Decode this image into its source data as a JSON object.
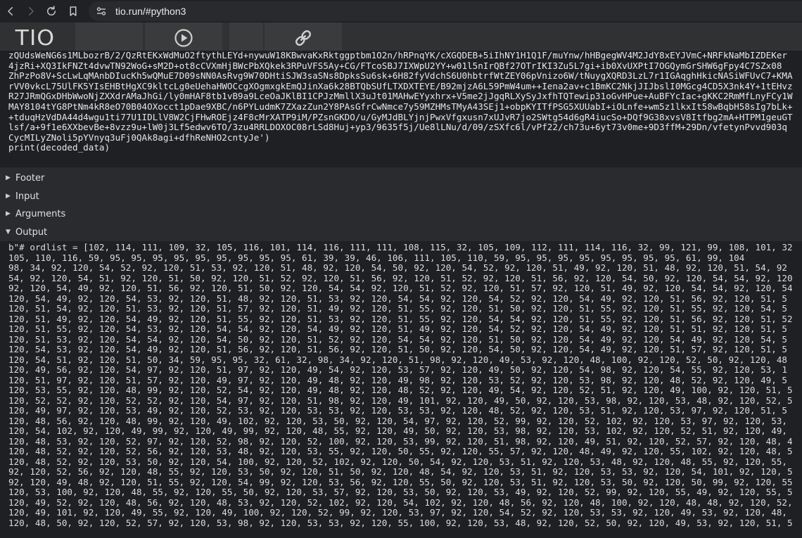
{
  "browser": {
    "url": "tio.run/#python3"
  },
  "toolbar": {
    "logo": "TIO"
  },
  "code": {
    "lines": [
      "zQUdsWeNG6s1MLbozrB/2/QzRtEKxWdMuO2ftythLEYd+nywuW18KBwvaKxRktggptbm1O2n/hRPnqYK/cXGQDEB+5iIhNY1H1Q1F/muYnw/hHBgegWV4M2JdY8xEYJVmC+NRFkNaMbIZDEKer",
      "4jzRi+XQ3IkFNZt4dvwTN92WoG+sM2D+ot8cCVXmHjBWcPbXQkek3RPuVFS5Ay+CG/FTcoSBJ7IXWpU2YY+w01l5nIrQBf27OTrIKI3Zu5L7gi+ib0XvUXPtI7OGQymGrSHW6gFpy4C7SZx08",
      "ZhPzPo8V+ScLwLqMAnbDIucKh5wQMuE7D09sNN0AsRvg9W70DHtiSJW3saSNs8DpksSu6sk+6H82fyVdchS6U0hbtrfWtZEY06pVnizo6W/tNuygXQRD3LzL7r1IGAqghHkicNASiWFUvC7+KMA",
      "rVV0vkcL75UlFK5YIsEHBtHgXC9kltcLg0eUehaHWOCcgXOgmxgkEmQJinXa6k28BTQbSUfLTXDXTEYE/B92mjzA6L59PmW4um++Iena2av+c1BmKC2NkjJIJbslI0MGcg4CD5X3nk4Y+1tEHvz",
      "R27JRmQGxDHbWwoNjZXXdrAMaJhGi/ly0mHAF8tb1vB9a9LceOaJKlBI1CPJzMmllX3uJt01MAHwEYyxhrx+V5me2jJgqRLXySyJxfhTQTewip31oGvHPue+AuBFYcIac+gKKC2RmMfLnyFCy1W",
      "MAY8104tYG8PtNm4kR8eO70B04OXocct1pDae9XBC/n6PYLudmK7ZXazZun2Y8PAsGfrCwNmce7y59MZHMsTMyA43SEj1+obpKYITfPSG5XUUabI+iOLnfe+wm5z1lkxIt58wBqbH58sIg7bLk+",
      "+tduqHzVdDA44d4wgu1ti77U1IDLlV8W2CjFHwROEjz4F8cMrXATP9iM/PZsnGKDO/u/GyMJdBLYjnjPwxVfgxusn7xUJvR7jo2SWtg54d6gR4iucSo+DQf9G38xvsV8Itfbg2mA+HTPM1geuGT",
      "lsf/a+9f1e6XXbevBe+8vzz9u+lW0j3Lf5edwv6TO/3zu4RRLDOXOC08rLSd8Huj+yp3/9635f5j/Ue8lLNu/d/09/zSXfc6l/vPf22/ch73u+6yt73v0me+9D3ffM+29Dn/vfetynPvvd903q",
      "CycMILyZNoli5pYVnyq3uFj0QAk8agi+dfhReNHO2cntyJe')",
      "print(decoded_data)"
    ]
  },
  "sections": {
    "footer": "Footer",
    "input": "Input",
    "arguments": "Arguments",
    "output": "Output"
  },
  "output": {
    "lines": [
      "b\"# ordlist = [102, 114, 111, 109, 32, 105, 116, 101, 114, 116, 111, 111, 108, 115, 32, 105, 109, 112, 111, 114, 116, 32, 99, 121, 99, 108, 101, 32",
      "105, 110, 116, 59, 95, 95, 95, 95, 95, 95, 95, 95, 95, 61, 39, 39, 46, 106, 111, 105, 110, 59, 95, 95, 95, 95, 95, 95, 95, 95, 61, 99, 104",
      "98, 34, 92, 120, 54, 52, 92, 120, 51, 53, 92, 120, 51, 48, 92, 120, 54, 50, 92, 120, 54, 52, 92, 120, 51, 49, 92, 120, 51, 48, 92, 120, 51, 54, 92",
      "54, 92, 120, 54, 51, 92, 120, 51, 50, 92, 120, 51, 52, 92, 120, 51, 56, 92, 120, 51, 52, 92, 120, 51, 56, 92, 120, 54, 50, 92, 120, 54, 54, 92, 120",
      "92, 120, 54, 49, 92, 120, 51, 56, 92, 120, 51, 50, 92, 120, 54, 54, 92, 120, 51, 52, 92, 120, 51, 57, 92, 120, 51, 49, 92, 120, 54, 54, 92, 120, 54",
      "120, 54, 49, 92, 120, 54, 53, 92, 120, 51, 48, 92, 120, 51, 53, 92, 120, 54, 54, 92, 120, 54, 52, 92, 120, 54, 49, 92, 120, 51, 56, 92, 120, 51, 5",
      "120, 51, 54, 92, 120, 51, 53, 92, 120, 51, 57, 92, 120, 51, 49, 92, 120, 51, 55, 92, 120, 51, 50, 92, 120, 51, 55, 92, 120, 51, 55, 92, 120, 54, 5",
      "120, 51, 49, 92, 120, 54, 49, 92, 120, 51, 55, 92, 120, 51, 53, 92, 120, 51, 55, 92, 120, 54, 54, 92, 120, 51, 55, 92, 120, 51, 56, 92, 120, 51, 52",
      "120, 51, 55, 92, 120, 54, 53, 92, 120, 54, 54, 92, 120, 54, 49, 92, 120, 51, 49, 92, 120, 54, 52, 92, 120, 54, 49, 92, 120, 51, 51, 92, 120, 51, 5",
      "120, 51, 53, 92, 120, 54, 54, 92, 120, 54, 50, 92, 120, 51, 52, 92, 120, 54, 54, 92, 120, 51, 50, 92, 120, 54, 49, 92, 120, 54, 49, 92, 120, 54, 5",
      "120, 54, 53, 92, 120, 54, 49, 92, 120, 51, 56, 92, 120, 51, 56, 92, 120, 51, 50, 92, 120, 54, 50, 92, 120, 54, 49, 92, 120, 51, 57, 92, 120, 51, 5",
      "120, 54, 51, 92, 120, 51, 50, 34, 59, 95, 95, 32, 61, 32, 98, 34, 92, 120, 51, 98, 92, 120, 49, 53, 92, 120, 48, 100, 92, 120, 52, 50, 92, 120, 48",
      "120, 49, 56, 92, 120, 54, 97, 92, 120, 51, 97, 92, 120, 49, 54, 92, 120, 53, 57, 92, 120, 49, 50, 92, 120, 54, 98, 92, 120, 54, 55, 92, 120, 53, 1",
      "120, 51, 97, 92, 120, 51, 57, 92, 120, 49, 97, 92, 120, 49, 48, 92, 120, 49, 98, 92, 120, 53, 52, 92, 120, 53, 98, 92, 120, 48, 52, 92, 120, 49, 5",
      "120, 53, 55, 92, 120, 48, 99, 92, 120, 52, 54, 92, 120, 49, 48, 92, 120, 48, 52, 92, 120, 49, 54, 92, 120, 52, 51, 92, 120, 49, 100, 92, 120, 51, 5",
      "120, 52, 52, 92, 120, 52, 52, 92, 120, 54, 97, 92, 120, 51, 98, 92, 120, 49, 101, 92, 120, 49, 50, 92, 120, 53, 98, 92, 120, 53, 48, 92, 120, 52, 5",
      "120, 49, 97, 92, 120, 53, 49, 92, 120, 52, 53, 92, 120, 53, 53, 92, 120, 53, 53, 92, 120, 48, 52, 92, 120, 53, 51, 92, 120, 53, 97, 92, 120, 51, 5",
      "120, 48, 56, 92, 120, 48, 99, 92, 120, 49, 102, 92, 120, 53, 50, 92, 120, 54, 97, 92, 120, 52, 99, 92, 120, 52, 102, 92, 120, 53, 97, 92, 120, 53,",
      "120, 54, 102, 92, 120, 49, 99, 92, 120, 49, 99, 92, 120, 48, 55, 92, 120, 49, 50, 92, 120, 53, 98, 92, 120, 53, 102, 92, 120, 52, 51, 92, 120, 49,",
      "120, 48, 53, 92, 120, 52, 97, 92, 120, 52, 98, 92, 120, 52, 100, 92, 120, 53, 99, 92, 120, 51, 98, 92, 120, 49, 51, 92, 120, 52, 57, 92, 120, 48, 4",
      "120, 48, 52, 92, 120, 52, 56, 92, 120, 53, 48, 92, 120, 53, 55, 92, 120, 50, 55, 92, 120, 55, 57, 92, 120, 48, 49, 92, 120, 55, 102, 92, 120, 48, 5",
      "120, 48, 52, 92, 120, 53, 50, 92, 120, 54, 100, 92, 120, 52, 102, 92, 120, 50, 54, 92, 120, 53, 51, 92, 120, 53, 48, 92, 120, 48, 55, 92, 120, 55,",
      "92, 120, 52, 56, 92, 120, 48, 55, 92, 120, 53, 50, 92, 120, 51, 50, 92, 120, 48, 54, 92, 120, 53, 51, 92, 120, 53, 53, 92, 120, 54, 101, 92, 120, 5",
      "92, 120, 49, 48, 92, 120, 51, 55, 92, 120, 54, 99, 92, 120, 53, 56, 92, 120, 55, 50, 92, 120, 53, 51, 92, 120, 53, 50, 92, 120, 50, 99, 92, 120, 55",
      "120, 53, 100, 92, 120, 48, 55, 92, 120, 55, 50, 92, 120, 53, 57, 92, 120, 53, 50, 92, 120, 53, 49, 92, 120, 52, 99, 92, 120, 55, 49, 92, 120, 55, 5",
      "120, 49, 52, 92, 120, 48, 56, 92, 120, 48, 53, 92, 120, 52, 102, 92, 120, 54, 102, 92, 120, 48, 56, 92, 120, 48, 100, 92, 120, 48, 48, 92, 120, 52,",
      "120, 49, 101, 92, 120, 49, 55, 92, 120, 49, 100, 92, 120, 52, 99, 92, 120, 53, 97, 92, 120, 54, 52, 92, 120, 53, 53, 92, 120, 49, 53, 92, 120, 48,",
      "120, 48, 50, 92, 120, 52, 57, 92, 120, 53, 98, 92, 120, 53, 53, 92, 120, 55, 100, 92, 120, 53, 48, 92, 120, 52, 50, 92, 120, 49, 53, 92, 120, 51, 5"
    ]
  }
}
